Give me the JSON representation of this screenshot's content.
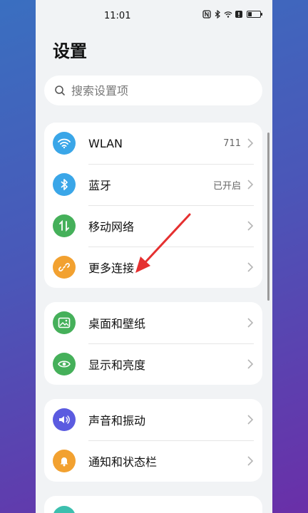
{
  "status": {
    "time": "11:01"
  },
  "page": {
    "title": "设置"
  },
  "search": {
    "placeholder": "搜索设置项"
  },
  "groups": [
    {
      "items": [
        {
          "label": "WLAN",
          "value": "711",
          "icon": "wifi-icon",
          "color": "#3aa6e8"
        },
        {
          "label": "蓝牙",
          "value": "已开启",
          "icon": "bluetooth-icon",
          "color": "#3aa6e8"
        },
        {
          "label": "移动网络",
          "value": "",
          "icon": "mobile-data-icon",
          "color": "#45b05a"
        },
        {
          "label": "更多连接",
          "value": "",
          "icon": "link-icon",
          "color": "#f2a130"
        }
      ]
    },
    {
      "items": [
        {
          "label": "桌面和壁纸",
          "value": "",
          "icon": "wallpaper-icon",
          "color": "#45b05a"
        },
        {
          "label": "显示和亮度",
          "value": "",
          "icon": "eye-icon",
          "color": "#45b05a"
        }
      ]
    },
    {
      "items": [
        {
          "label": "声音和振动",
          "value": "",
          "icon": "volume-icon",
          "color": "#5b5be0"
        },
        {
          "label": "通知和状态栏",
          "value": "",
          "icon": "bell-icon",
          "color": "#f2a130"
        }
      ]
    }
  ],
  "colors": {
    "annotation_arrow": "#e53030"
  }
}
